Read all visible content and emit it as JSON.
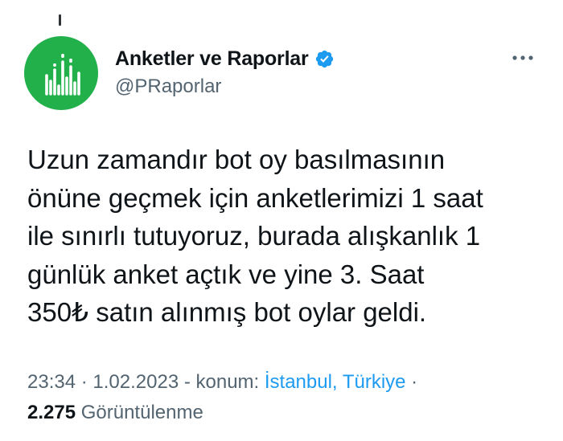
{
  "author": {
    "display_name": "Anketler ve Raporlar",
    "handle": "@PRaporlar",
    "verified": true,
    "avatar_icon": "bar-chart-logo-icon",
    "avatar_color": "#22b04b"
  },
  "tweet": {
    "text_lines": [
      "Uzun zamandır bot oy basılmasının",
      "önüne geçmek için anketlerimizi 1 saat",
      "ile sınırlı tutuyoruz, burada alışkanlık 1",
      "günlük anket açtık ve yine 3. Saat",
      "350₺ satın alınmış bot oylar geldi."
    ]
  },
  "meta": {
    "time": "23:34",
    "sep1": " · ",
    "date": "1.02.2023",
    "location_prefix": " - konum: ",
    "location": "İstanbul, Türkiye",
    "sep2": " ·"
  },
  "views": {
    "count": "2.275",
    "label": " Görüntülenme"
  },
  "colors": {
    "text": "#0f1419",
    "secondary": "#536471",
    "accent": "#1d9bf0"
  }
}
